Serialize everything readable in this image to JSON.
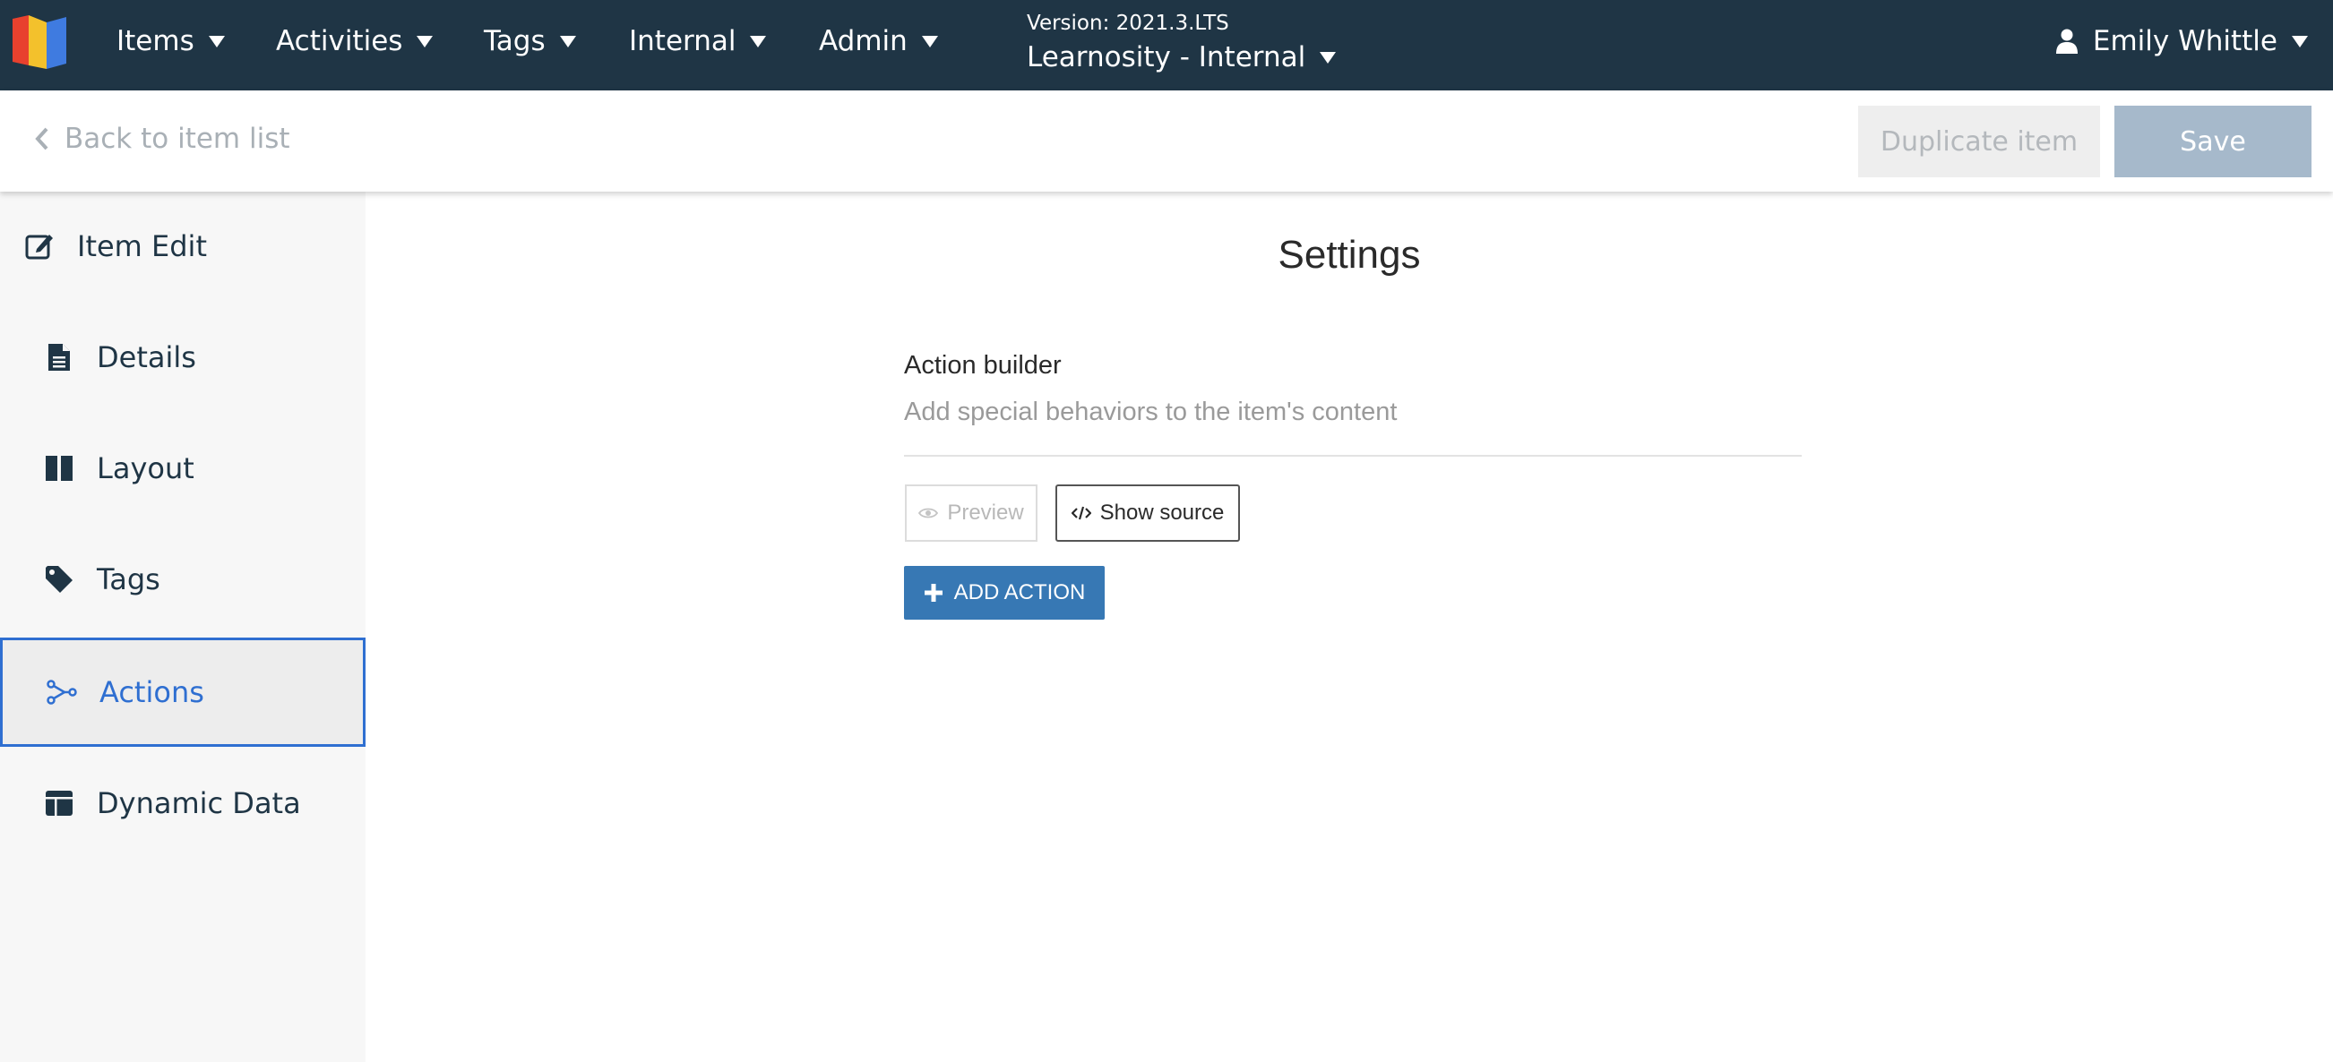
{
  "app": {
    "logo_colors": [
      "#e8412e",
      "#f3c12c",
      "#3f7be0"
    ]
  },
  "topnav": {
    "items": [
      {
        "label": "Items"
      },
      {
        "label": "Activities"
      },
      {
        "label": "Tags"
      },
      {
        "label": "Internal"
      },
      {
        "label": "Admin"
      }
    ],
    "version_label": "Version: 2021.3.LTS",
    "organization": "Learnosity - Internal",
    "user_name": "Emily Whittle"
  },
  "toolbar": {
    "back_label": "Back to item list",
    "duplicate_label": "Duplicate item",
    "save_label": "Save"
  },
  "sidebar": {
    "items": [
      {
        "label": "Item Edit",
        "icon": "edit-icon"
      },
      {
        "label": "Details",
        "icon": "document-icon"
      },
      {
        "label": "Layout",
        "icon": "columns-icon"
      },
      {
        "label": "Tags",
        "icon": "tag-icon"
      },
      {
        "label": "Actions",
        "icon": "actions-icon",
        "active": true
      },
      {
        "label": "Dynamic Data",
        "icon": "table-icon"
      }
    ]
  },
  "main": {
    "title": "Settings",
    "section_title": "Action builder",
    "section_description": "Add special behaviors to the item's content",
    "preview_label": "Preview",
    "show_source_label": "Show source",
    "add_action_label": "ADD ACTION"
  },
  "colors": {
    "nav_bg": "#1f3545",
    "accent": "#2f6fd1",
    "primary_button": "#3778b4",
    "save_disabled": "#a6b9cb"
  }
}
